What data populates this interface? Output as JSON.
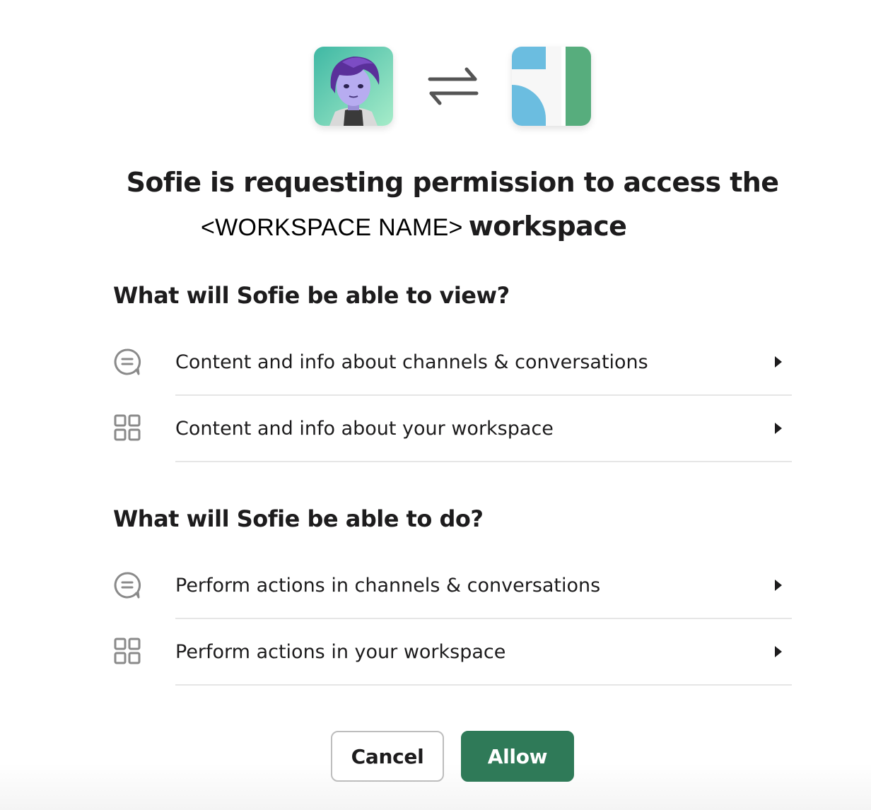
{
  "header": {
    "requesting_app_icon": "avatar-purple-hair-icon",
    "connection_icon": "swap-arrows-icon",
    "workspace_icon": "workspace-logo-icon"
  },
  "title": {
    "line1": "Sofie is requesting permission to access the",
    "workspace_placeholder": "<WORKSPACE NAME>",
    "workspace_word": "workspace"
  },
  "view_section": {
    "heading": "What will Sofie be able to view?",
    "items": [
      {
        "label": "Content and info about channels & conversations",
        "icon": "chat-bubble-icon"
      },
      {
        "label": "Content and info about your workspace",
        "icon": "grid-icon"
      }
    ]
  },
  "do_section": {
    "heading": "What will Sofie be able to do?",
    "items": [
      {
        "label": "Perform actions in channels & conversations",
        "icon": "chat-bubble-icon"
      },
      {
        "label": "Perform actions in your workspace",
        "icon": "grid-icon"
      }
    ]
  },
  "buttons": {
    "cancel_label": "Cancel",
    "allow_label": "Allow"
  },
  "colors": {
    "allow_button": "#2f7a58",
    "text": "#1d1c1d",
    "icon_gray": "#8a8a8a",
    "divider": "#e6e6e6"
  }
}
